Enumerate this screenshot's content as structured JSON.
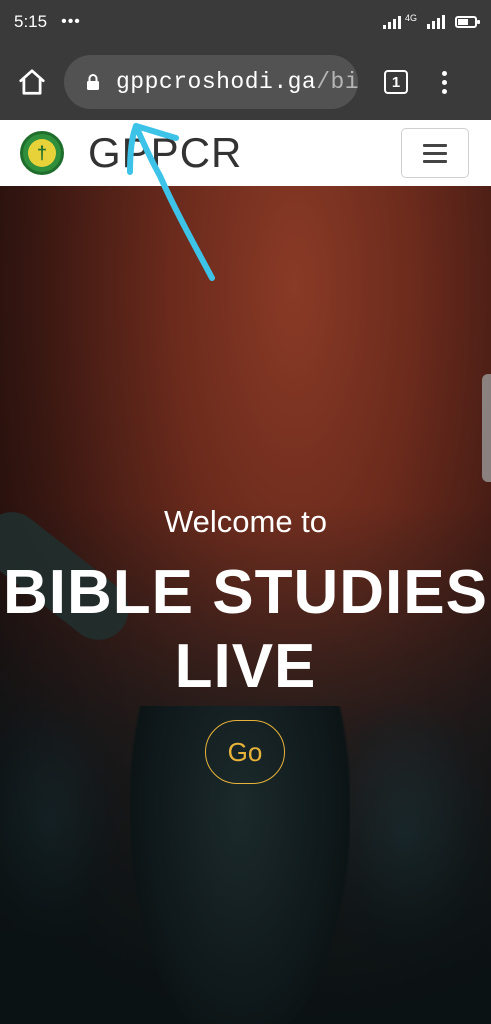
{
  "status_bar": {
    "time": "5:15",
    "dots": "•••",
    "network_badge": "4G"
  },
  "browser": {
    "url_domain": "gppcroshodi.ga",
    "url_path": "/bib",
    "tab_count": "1"
  },
  "site_nav": {
    "brand": "GPPCR",
    "logo_symbol": "†"
  },
  "hero": {
    "welcome": "Welcome to",
    "title": "BIBLE STUDIES LIVE",
    "button_label": "Go"
  },
  "colors": {
    "status_bar_bg": "#3a3a3a",
    "go_button": "#e8b33a",
    "annotation_arrow": "#3ec3e8"
  }
}
